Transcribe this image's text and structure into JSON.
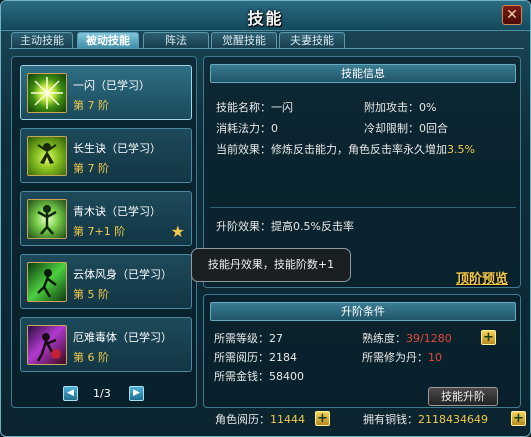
{
  "window": {
    "title": "技能",
    "close_label": "✕"
  },
  "tabs": [
    {
      "label": "主动技能",
      "active": false
    },
    {
      "label": "被动技能",
      "active": true
    },
    {
      "label": "阵法",
      "active": false
    },
    {
      "label": "觉醒技能",
      "active": false
    },
    {
      "label": "夫妻技能",
      "active": false
    }
  ],
  "skills": [
    {
      "name": "一闪（已学习）",
      "level": "第 7 阶",
      "icon": "lightning-burst-icon",
      "selected": true
    },
    {
      "name": "长生诀（已学习）",
      "level": "第 7 阶",
      "icon": "figure-aura-icon",
      "selected": false
    },
    {
      "name": "青木诀（已学习）",
      "level": "第 7+1 阶",
      "icon": "wood-spirit-icon",
      "selected": false,
      "star": true
    },
    {
      "name": "云体风身（已学习）",
      "level": "第 5 阶",
      "icon": "wind-body-icon",
      "selected": false
    },
    {
      "name": "厄难毒体（已学习）",
      "level": "第 6 阶",
      "icon": "poison-body-icon",
      "selected": false
    }
  ],
  "pager": {
    "text": "1/3",
    "prev": "◀",
    "next": "▶"
  },
  "info": {
    "header": "技能信息",
    "name_label": "技能名称：",
    "name_value": "一闪",
    "bonus_label": "附加攻击：",
    "bonus_value": "0%",
    "mp_label": "消耗法力：",
    "mp_value": "0",
    "cd_label": "冷却限制：",
    "cd_value": "0回合",
    "effect_label": "当前效果：",
    "effect_text": "修炼反击能力，角色反击率永久增加",
    "effect_value": "3.5%",
    "upgrade_label": "升阶效果：",
    "upgrade_text": "提高0.5%反击率"
  },
  "tooltip": "技能丹效果，技能阶数+1",
  "top_preview": "顶阶预览",
  "conditions": {
    "header": "升阶条件",
    "level_label": "所需等级：",
    "level_value": "27",
    "prof_label": "熟练度：",
    "prof_value": "39/1280",
    "exp_label": "所需阅历：",
    "exp_value": "2184",
    "pill_label": "所需修为丹：",
    "pill_value": "10",
    "gold_label": "所需金钱：",
    "gold_value": "58400",
    "upgrade_button": "技能升阶",
    "plus": "+"
  },
  "footer": {
    "exp_label": "角色阅历：",
    "exp_value": "11444",
    "copper_label": "拥有铜钱：",
    "copper_value": "2118434649",
    "plus": "+"
  },
  "colors": {
    "highlight": "#f3c94b",
    "warning": "#e34a3a",
    "accent": "#6fb0c4"
  }
}
